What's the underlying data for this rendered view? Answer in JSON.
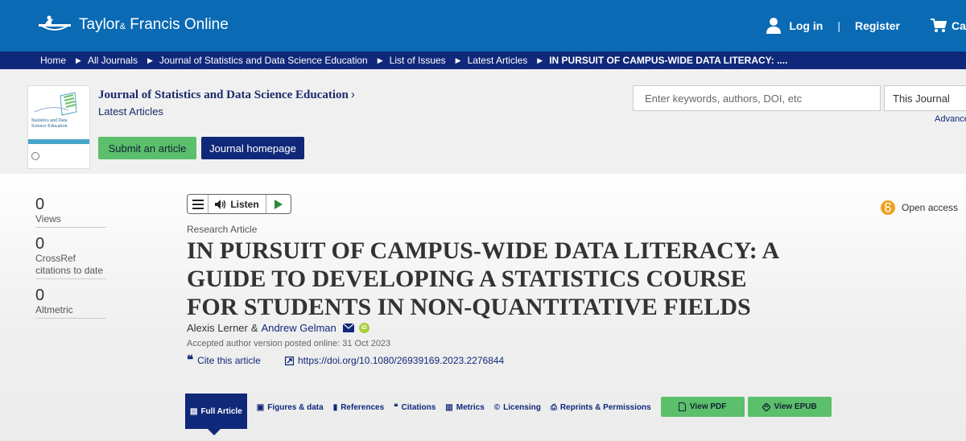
{
  "header": {
    "logo_brand": "Taylor",
    "logo_amp": "&",
    "logo_rest": " Francis Online",
    "login": "Log in",
    "separator": "|",
    "register": "Register",
    "cart": "Cart"
  },
  "breadcrumb": [
    "Home",
    "All Journals",
    "Journal of Statistics and Data Science Education",
    "List of Issues",
    "Latest Articles",
    "IN PURSUIT OF CAMPUS-WIDE DATA LITERACY: ...."
  ],
  "journal": {
    "title": "Journal of Statistics and Data Science Education",
    "chevron": "›",
    "subtitle": "Latest Articles",
    "submit": "Submit an article",
    "homepage": "Journal homepage",
    "cover_text": "Statistics and Data Science Education"
  },
  "search": {
    "placeholder": "Enter keywords, authors, DOI, etc",
    "scope": "This Journal",
    "advanced": "Advanced search"
  },
  "metrics": [
    {
      "value": "0",
      "label": "Views"
    },
    {
      "value": "0",
      "label": "CrossRef citations to date"
    },
    {
      "value": "0",
      "label": "Altmetric"
    }
  ],
  "toolbar": {
    "listen": "Listen"
  },
  "article": {
    "open_access": "Open access",
    "type": "Research Article",
    "title": "IN PURSUIT OF CAMPUS-WIDE DATA LITERACY: A GUIDE TO DEVELOPING A STATISTICS COURSE FOR STUDENTS IN NON-QUANTITATIVE FIELDS",
    "author1": "Alexis Lerner",
    "amp": "&",
    "author2": "Andrew Gelman",
    "orcid": "iD",
    "posted": "Accepted author version posted online: 31 Oct 2023",
    "cite": "Cite this article",
    "doi": "https://doi.org/10.1080/26939169.2023.2276844"
  },
  "tabs": {
    "full_article": "Full Article",
    "figures": "Figures & data",
    "references": "References",
    "citations": "Citations",
    "metrics": "Metrics",
    "licensing": "Licensing",
    "reprints": "Reprints & Permissions",
    "view_pdf": "View PDF",
    "view_epub": "View EPUB"
  },
  "colors": {
    "header_blue": "#0a6ab3",
    "navy": "#10287a",
    "green": "#5cbf6b",
    "oa_orange": "#f0a020"
  }
}
